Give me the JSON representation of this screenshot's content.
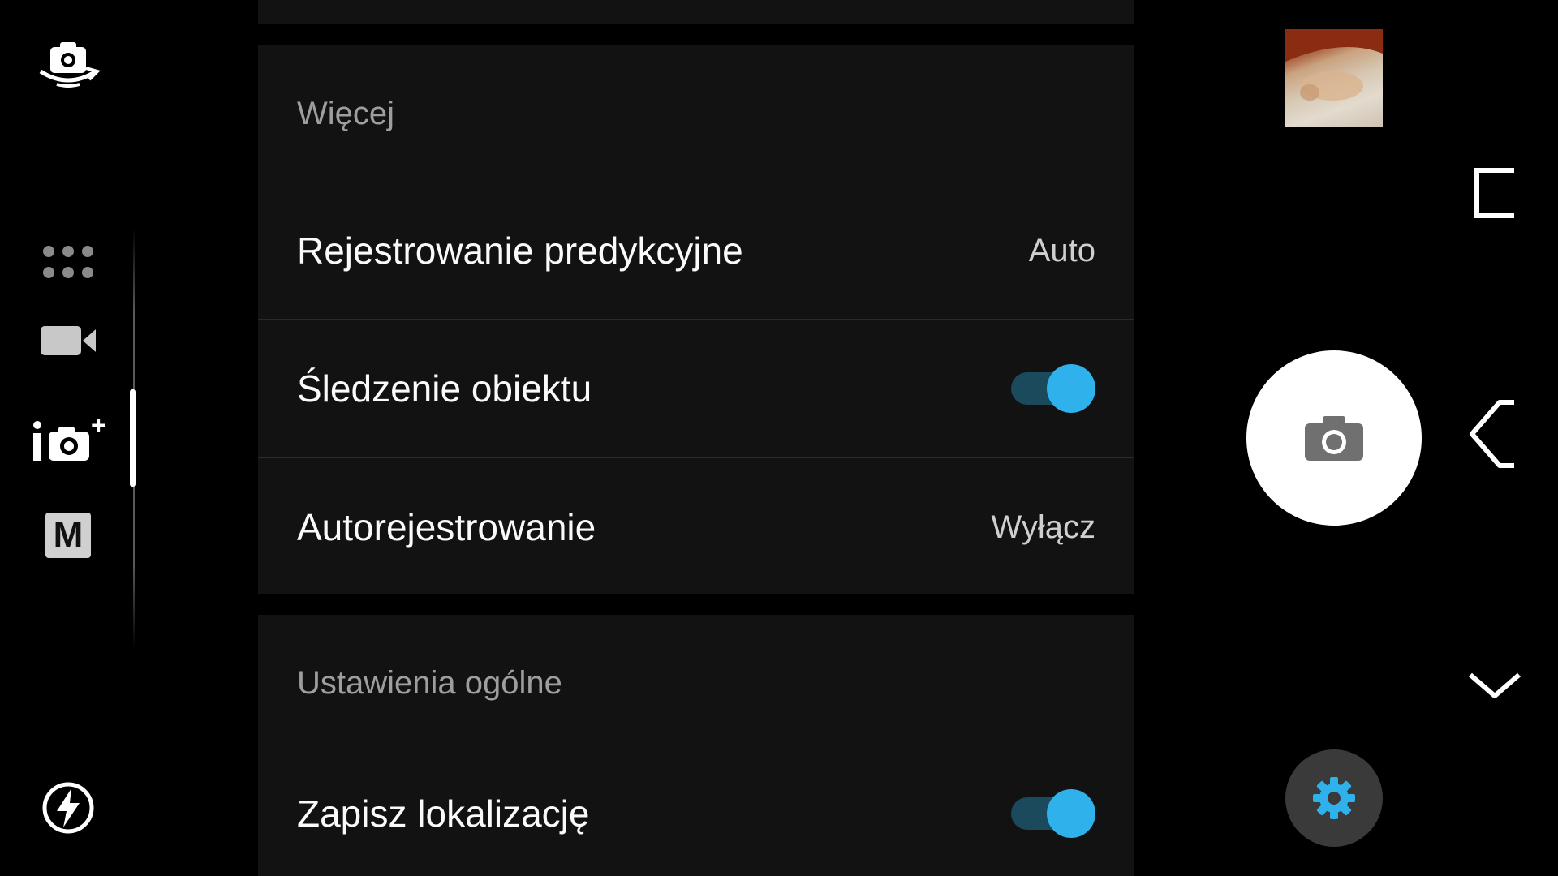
{
  "sections": [
    {
      "header": "Więcej",
      "rows": [
        {
          "label": "Rejestrowanie predykcyjne",
          "value": "Auto",
          "type": "value"
        },
        {
          "label": "Śledzenie obiektu",
          "value": "on",
          "type": "toggle"
        },
        {
          "label": "Autorejestrowanie",
          "value": "Wyłącz",
          "type": "value"
        }
      ]
    },
    {
      "header": "Ustawienia ogólne",
      "rows": [
        {
          "label": "Zapisz lokalizację",
          "value": "on",
          "type": "toggle"
        }
      ]
    }
  ],
  "left_rail": {
    "icons": [
      "switch-camera-icon",
      "app-grid-icon",
      "video-mode-icon",
      "superior-auto-icon",
      "manual-mode-icon",
      "flash-auto-icon"
    ],
    "manual_mode_letter": "M",
    "superior_auto_plus": "+"
  },
  "right_controls": {
    "icons": [
      "last-photo-thumbnail",
      "shutter-camera-icon",
      "settings-gear-icon"
    ]
  },
  "nav_bar": {
    "icons": [
      "recents-icon",
      "back-icon",
      "collapse-chevron-icon"
    ]
  },
  "colors": {
    "accent": "#2fb1ec",
    "toggle_track": "#1b4a5c",
    "panel_bg": "#121212",
    "background": "#000000",
    "header_text": "#9e9e9e",
    "settings_button_bg": "#3a3a3a"
  }
}
